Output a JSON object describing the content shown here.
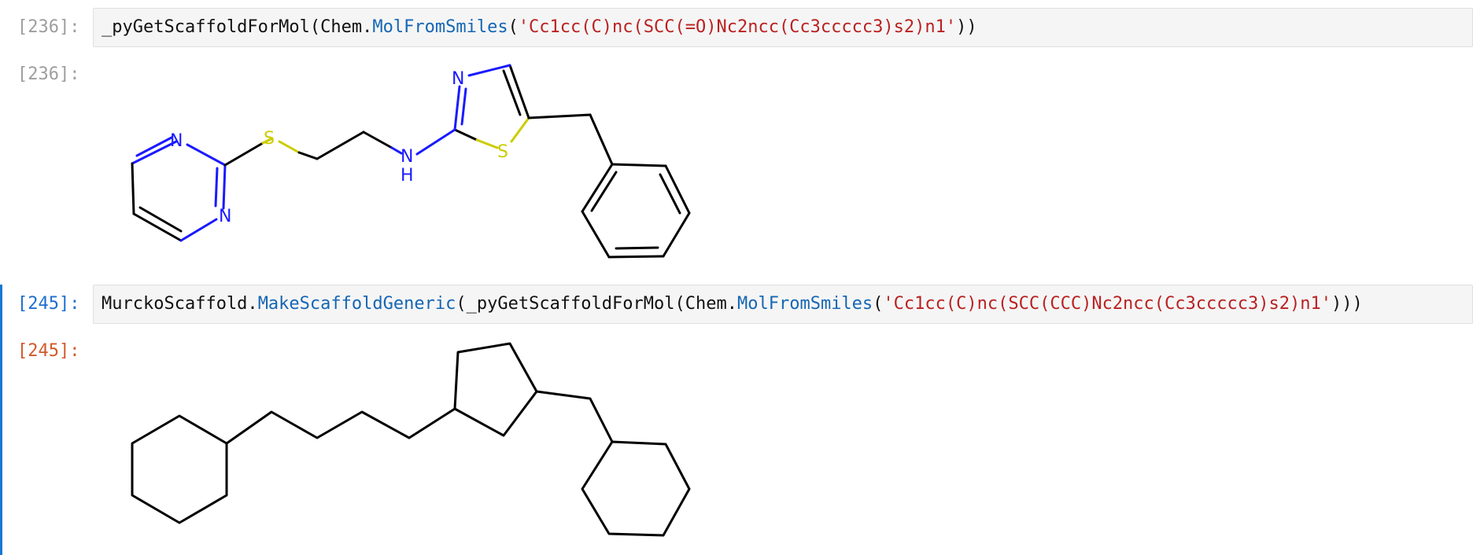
{
  "cells": [
    {
      "prompt_in": "[236]:",
      "code": {
        "p1": "_pyGetScaffoldForMol(Chem.",
        "f1": "MolFromSmiles",
        "p2": "(",
        "s1": "'Cc1cc(C)nc(SCC(=O)Nc2ncc(Cc3ccccc3)s2)n1'",
        "p3": "))"
      },
      "prompt_out": "[236]:",
      "molecule_atoms": {
        "n1": "N",
        "n2": "N",
        "s1": "S",
        "nh_n": "N",
        "nh_h": "H",
        "n3": "N",
        "s2": "S"
      }
    },
    {
      "prompt_in": "[245]:",
      "code": {
        "p1": "MurckoScaffold.",
        "f1": "MakeScaffoldGeneric",
        "p2": "(_pyGetScaffoldForMol(Chem.",
        "f2": "MolFromSmiles",
        "p3": "(",
        "s1": "'Cc1cc(C)nc(SCC(CCC)Nc2ncc(Cc3ccccc3)s2)n1'",
        "p4": ")))"
      },
      "prompt_out": "[245]:"
    }
  ],
  "colors": {
    "prompt_idle": "#9e9e9e",
    "prompt_in_active": "#1f6fd0",
    "prompt_out_active": "#d35a2b",
    "function": "#1566b4",
    "string": "#ba2121",
    "nitrogen": "#1a1aff",
    "sulfur": "#cccc00",
    "active_bar": "#1976d2"
  }
}
